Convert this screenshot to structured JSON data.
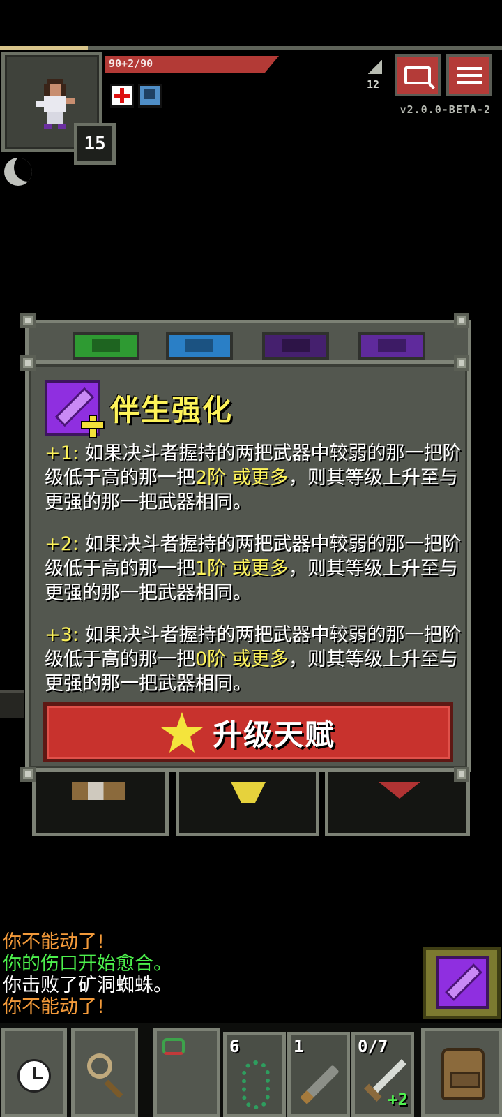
{
  "hud": {
    "hp_text": "90+2/90",
    "hp_fraction": 1.0,
    "hero_level": "15",
    "depth": "12",
    "version": "v2.0.0-BETA-2",
    "buffs": [
      "healing-icon",
      "shield-icon"
    ],
    "colors": {
      "hp": "#b33a36",
      "accent_yellow": "#fdf35a",
      "panel": "#53574f"
    }
  },
  "talent_window": {
    "tabs": [
      "tab-tier-1",
      "tab-tier-2",
      "tab-tier-3",
      "tab-tier-4"
    ],
    "talent": {
      "icon": "dueling-swords-plus-icon",
      "title": "伴生强化",
      "levels": [
        {
          "prefix": "+1:",
          "text_a": " 如果决斗者握持的两把武器中较弱的那一把阶级低于高的那一把",
          "highlight": "2阶 或更多",
          "text_b": "，则其等级上升至与更强的那一把武器相同。"
        },
        {
          "prefix": "+2:",
          "text_a": " 如果决斗者握持的两把武器中较弱的那一把阶级低于高的那一把",
          "highlight": "1阶 或更多",
          "text_b": "，则其等级上升至与更强的那一把武器相同。"
        },
        {
          "prefix": "+3:",
          "text_a": " 如果决斗者握持的两把武器中较弱的那一把阶级低于高的那一把",
          "highlight": "0阶 或更多",
          "text_b": "，则其等级上升至与更强的那一把武器相同。"
        }
      ],
      "upgrade_label": "升级天赋"
    }
  },
  "log": [
    {
      "text": "你不能动了!",
      "color": "#f39a3a"
    },
    {
      "text": "你的伤口开始愈合。",
      "color": "#4cf04c"
    },
    {
      "text": "你击败了矿洞蜘蛛。",
      "color": "#ffffff"
    },
    {
      "text": "你不能动了!",
      "color": "#f39a3a"
    }
  ],
  "toolbar": {
    "quickslots": [
      {
        "icon": "chain-icon",
        "count": "6"
      },
      {
        "icon": "dart-icon",
        "count": "1"
      },
      {
        "icon": "sword-icon",
        "count": "0/7",
        "level": "+2"
      }
    ]
  }
}
